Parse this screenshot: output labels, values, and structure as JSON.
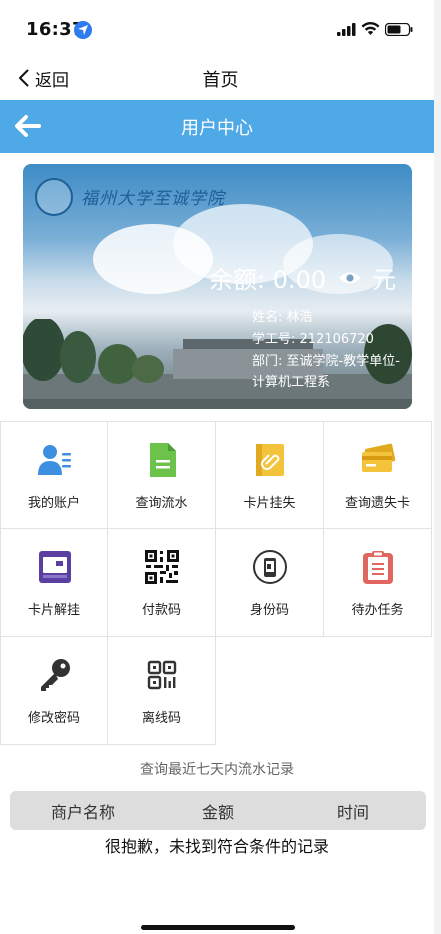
{
  "status": {
    "time": "16:37"
  },
  "nav": {
    "back_label": "返回",
    "title": "首页"
  },
  "header": {
    "title": "用户中心"
  },
  "card": {
    "school_name": "福州大学至诚学院",
    "balance_label": "余额: 0.00",
    "currency": "元",
    "name_line": "姓名: 林浩",
    "id_line": "学工号: 212106720",
    "dept_line1": "部门: 至诚学院-教学单位-",
    "dept_line2": "计算机工程系"
  },
  "menu": [
    {
      "label": "我的账户",
      "icon": "account-icon"
    },
    {
      "label": "查询流水",
      "icon": "transactions-icon"
    },
    {
      "label": "卡片挂失",
      "icon": "card-lost-icon"
    },
    {
      "label": "查询遗失卡",
      "icon": "lost-card-search-icon"
    },
    {
      "label": "卡片解挂",
      "icon": "card-unlock-icon"
    },
    {
      "label": "付款码",
      "icon": "qr-payment-icon"
    },
    {
      "label": "身份码",
      "icon": "identity-code-icon"
    },
    {
      "label": "待办任务",
      "icon": "todo-clipboard-icon"
    },
    {
      "label": "修改密码",
      "icon": "key-icon"
    },
    {
      "label": "离线码",
      "icon": "offline-qr-icon"
    }
  ],
  "records": {
    "hint": "查询最近七天内流水记录",
    "columns": [
      "商户名称",
      "金额",
      "时间"
    ],
    "empty_message": "很抱歉，未找到符合条件的记录"
  },
  "colors": {
    "header_blue": "#4fa9e6",
    "icon_blue": "#3d8fe0",
    "icon_green": "#6cc24a",
    "icon_yellow": "#f3c33b",
    "icon_purple": "#5b3fa0",
    "icon_red": "#e0665f"
  }
}
